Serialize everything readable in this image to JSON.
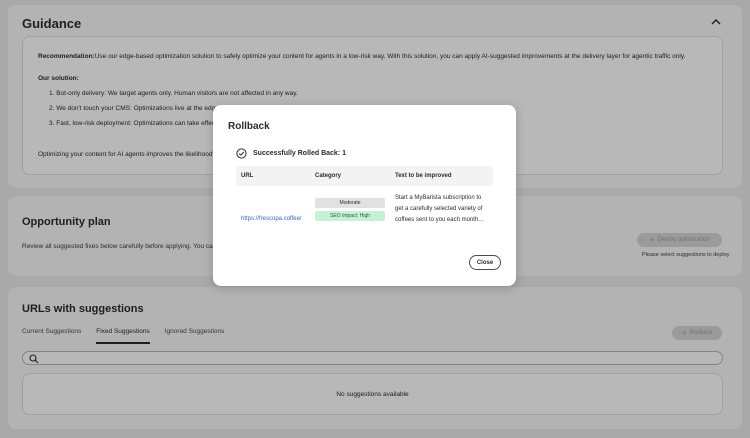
{
  "guidance": {
    "title": "Guidance",
    "recommendation_label": "Recommendation:",
    "recommendation_text": "Use our edge-based optimization solution to safely optimize your content for agents in a low-risk way. With this solution, you can apply AI-suggested improvements at the delivery layer for agentic traffic only.",
    "our_solution_label": "Our solution:",
    "points": [
      "1. Bot-only delivery: We target agents only. Human visitors are not affected in any way.",
      "2. We don't touch your CMS: Optimizations live at the edge of",
      "3. Fast, low-risk deployment: Optimizations can take effect in"
    ],
    "footer_text": "Optimizing your content for AI agents improves the likelihood of L"
  },
  "opportunity": {
    "title": "Opportunity plan",
    "description": "Review all suggested fixes below carefully before applying. You can dis",
    "deploy_button": "Deploy optimization",
    "deploy_hint": "Please select suggestions to deploy"
  },
  "urls_section": {
    "title": "URLs with suggestions",
    "tabs": [
      "Current Suggestions",
      "Fixed Suggestions",
      "Ignored Suggestions"
    ],
    "active_tab": 1,
    "rollback_button": "Rollback",
    "search_placeholder": "",
    "empty_text": "No suggestions available"
  },
  "modal": {
    "title": "Rollback",
    "status_text": "Successfully Rolled Back: 1",
    "columns": [
      "URL",
      "Category",
      "Text to be improved"
    ],
    "row": {
      "url": "https://frescopa.coffee/",
      "category_badge": "Moderate",
      "impact_badge": "SEO Impact: High",
      "text_lines": [
        "Start a MyBarista subscription to",
        "get a carefully selected variety of",
        "coffees sent to you each month..."
      ]
    },
    "close_button": "Close"
  },
  "colors": {
    "link": "#3a64c4",
    "seo_badge_bg": "#c6f1d6",
    "overlay": "rgba(0,0,0,0.28)"
  }
}
